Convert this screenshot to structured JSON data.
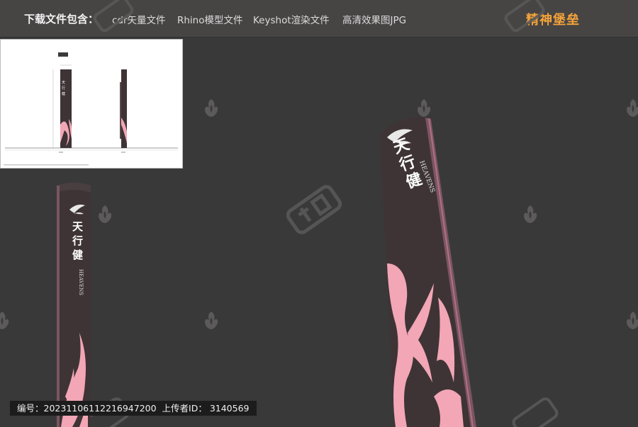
{
  "header": {
    "lead_label": "下载文件包含：",
    "items": [
      "cdr矢量文件",
      "Rhino模型文件",
      "Keyshot渲染文件",
      "高清效果图JPG"
    ],
    "brand": "精神堡垒"
  },
  "product": {
    "name_cn": "天行健",
    "name_en": "HEAVENS"
  },
  "info": {
    "id_label": "编号：",
    "id_value": "20231106112216947200",
    "uploader_label": "上传者ID：",
    "uploader_value": "3140569"
  },
  "colors": {
    "background": "#3a3939",
    "topbar": "#474444",
    "brand_accent": "#f3a33a",
    "pillar_body": "#3e3435",
    "pillar_pink": "#f2a6b6"
  }
}
